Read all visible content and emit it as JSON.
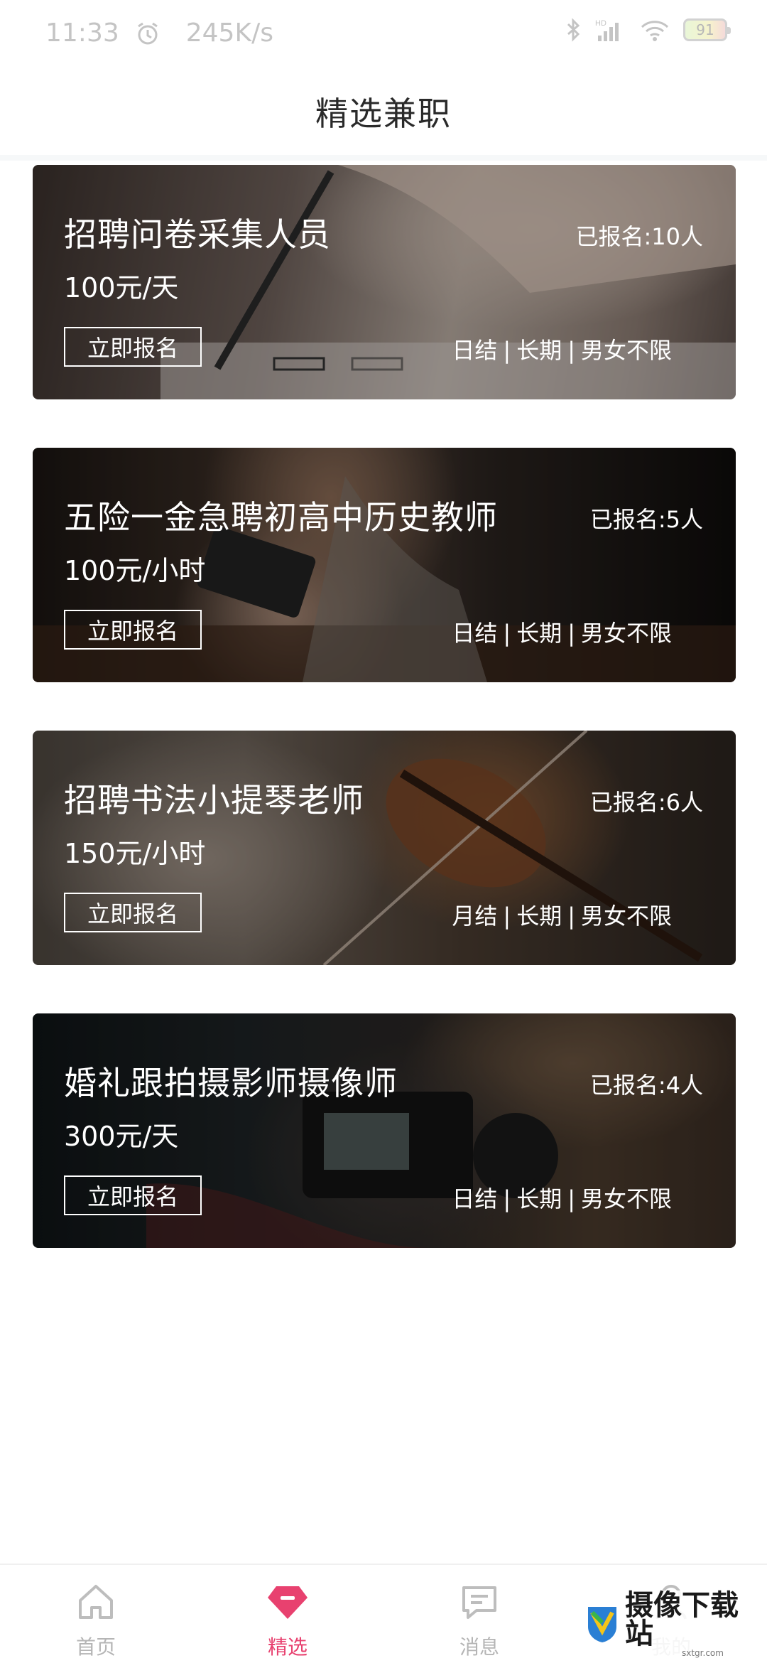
{
  "status_bar": {
    "time": "11:33",
    "speed": "245K/s",
    "battery": "91",
    "icons": [
      "alarm-icon",
      "bluetooth-icon",
      "hd-signal-icon",
      "wifi-icon",
      "battery-icon"
    ]
  },
  "header": {
    "title": "精选兼职"
  },
  "jobs": [
    {
      "title": "招聘问卷采集人员",
      "count": "已报名:10人",
      "salary": "100元/天",
      "apply": "立即报名",
      "tags": [
        "日结",
        "长期",
        "男女不限"
      ]
    },
    {
      "title": "五险一金急聘初高中历史教师",
      "count": "已报名:5人",
      "salary": "100元/小时",
      "apply": "立即报名",
      "tags": [
        "日结",
        "长期",
        "男女不限"
      ]
    },
    {
      "title": "招聘书法小提琴老师",
      "count": "已报名:6人",
      "salary": "150元/小时",
      "apply": "立即报名",
      "tags": [
        "月结",
        "长期",
        "男女不限"
      ]
    },
    {
      "title": "婚礼跟拍摄影师摄像师",
      "count": "已报名:4人",
      "salary": "300元/天",
      "apply": "立即报名",
      "tags": [
        "日结",
        "长期",
        "男女不限"
      ]
    }
  ],
  "tabs": [
    {
      "label": "首页",
      "icon": "home-icon",
      "active": false
    },
    {
      "label": "精选",
      "icon": "gem-icon",
      "active": true
    },
    {
      "label": "消息",
      "icon": "message-icon",
      "active": false
    },
    {
      "label": "我的",
      "icon": "user-icon",
      "active": false
    }
  ],
  "watermark": {
    "text": "摄像下载站",
    "sub": "sxtgr.com"
  },
  "colors": {
    "accent": "#e8416f",
    "tab_inactive": "#b5b5b5"
  }
}
